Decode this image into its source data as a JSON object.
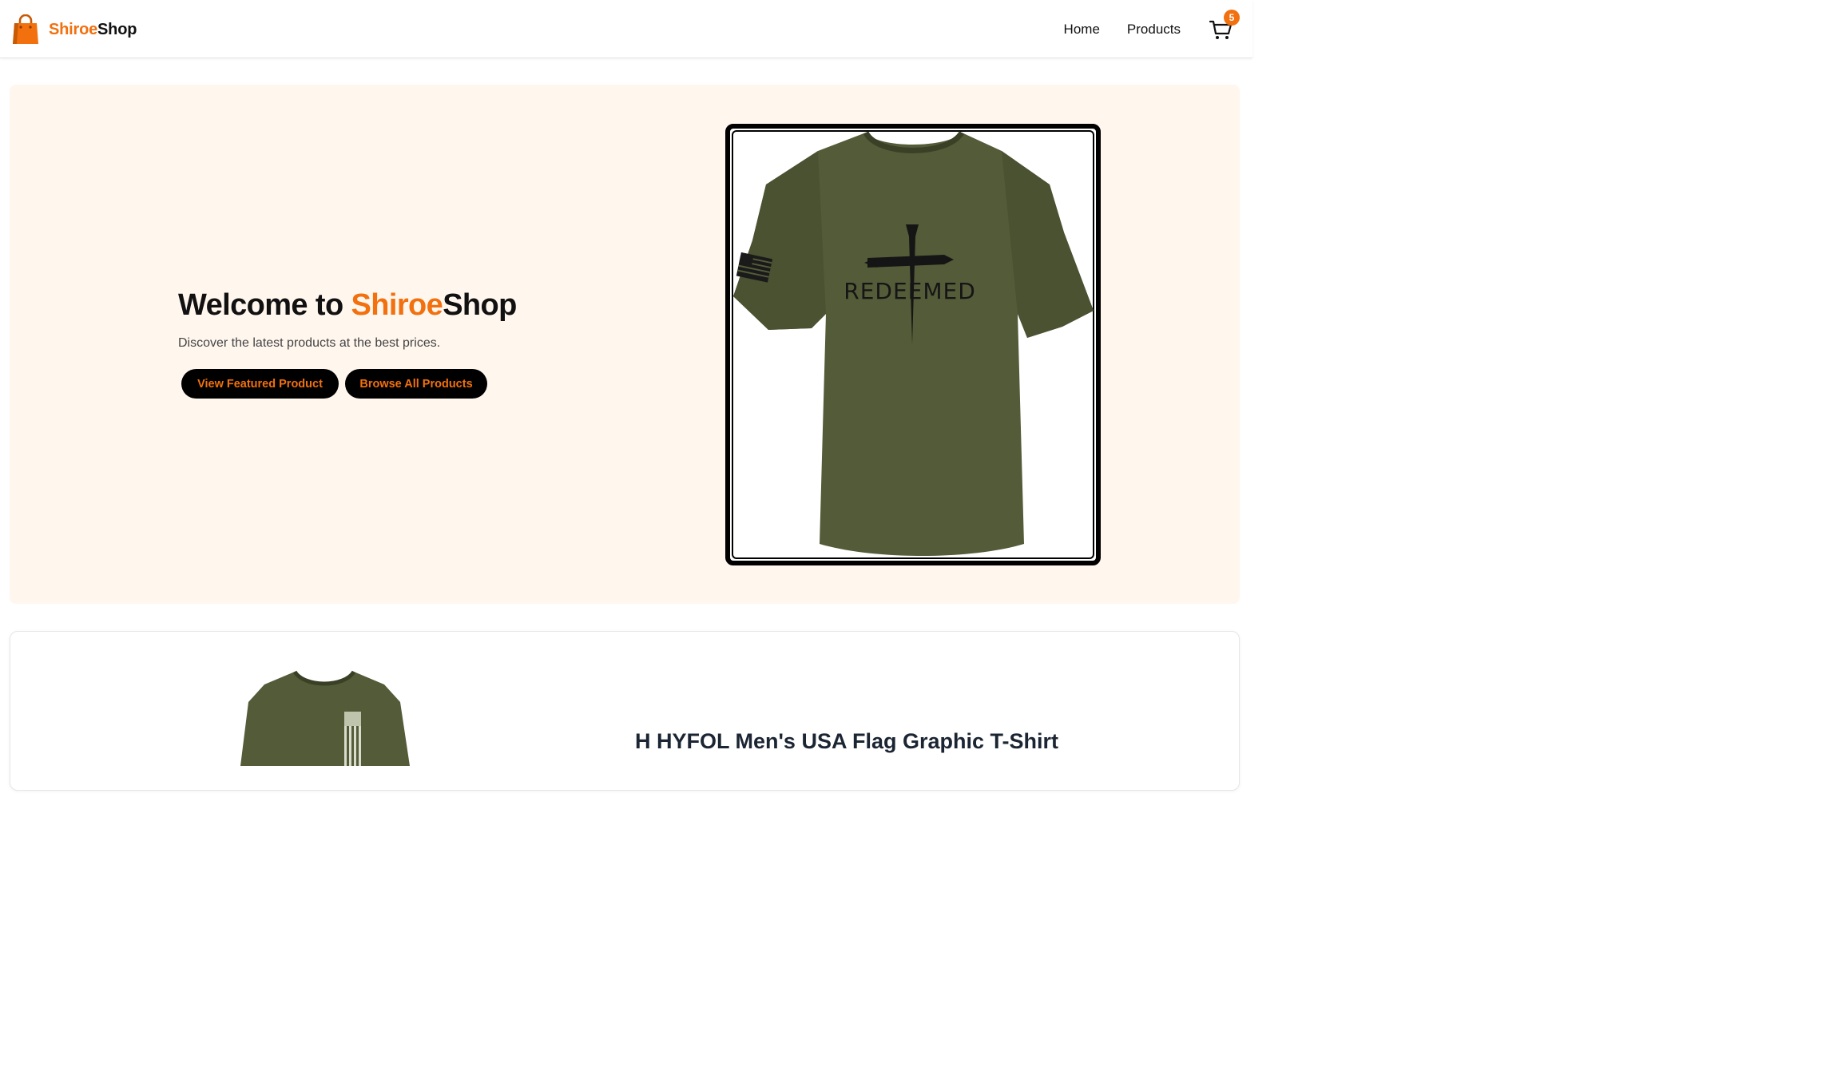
{
  "navbar": {
    "brand_accent": "Shiroe",
    "brand_rest": "Shop",
    "logo_icon": "shopping-bag-icon",
    "links": [
      {
        "label": "Home"
      },
      {
        "label": "Products"
      }
    ],
    "cart_icon": "cart-icon",
    "cart_count": "5"
  },
  "hero": {
    "title_prefix": "Welcome to ",
    "title_accent": "Shiroe",
    "title_rest": "Shop",
    "subtitle": "Discover the latest products at the best prices.",
    "primary_button": "View Featured Product",
    "secondary_button": "Browse All Products",
    "image_text": "REDEEMED",
    "image_icon": "olive-tshirt-image"
  },
  "featured": {
    "title": "H HYFOL Men's USA Flag Graphic T-Shirt",
    "image_icon": "olive-flag-tshirt-image"
  },
  "colors": {
    "accent": "#f2700e",
    "hero_bg": "#fff6ee",
    "shirt": "#535b38"
  }
}
